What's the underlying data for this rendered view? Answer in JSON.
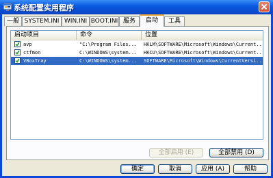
{
  "window": {
    "title": "系统配置实用程序"
  },
  "tabs": [
    {
      "label": "一般"
    },
    {
      "label": "SYSTEM.INI"
    },
    {
      "label": "WIN.INI"
    },
    {
      "label": "BOOT.INI"
    },
    {
      "label": "服务"
    },
    {
      "label": "启动",
      "active": true
    },
    {
      "label": "工具"
    }
  ],
  "startup": {
    "columns": [
      "启动项目",
      "命令",
      "位置"
    ],
    "rows": [
      {
        "checked": true,
        "item": "avp",
        "command": "\"C:\\Program Files...",
        "location": "HKLM\\SOFTWARE\\Microsoft\\Windows\\Current..."
      },
      {
        "checked": true,
        "item": "ctfmon",
        "command": "C:\\WINDOWS\\system...",
        "location": "HKCU\\SOFTWARE\\Microsoft\\Windows\\Current..."
      },
      {
        "checked": true,
        "item": "VBoxTray",
        "command": "C:\\WINDOWS\\system...",
        "location": "SOFTWARE\\Microsoft\\Windows\\CurrentVersi...",
        "selected": true
      }
    ],
    "enable_all": "全部启用 (E)",
    "disable_all": "全部禁用 (D)"
  },
  "footer": {
    "ok": "确定",
    "cancel": "取消",
    "apply": "应用 (A)",
    "help": "帮助"
  },
  "colors": {
    "titlebar": "#0a4fd3",
    "selection": "#316ac5",
    "active_tab_accent": "#f7a83c",
    "close_button": "#d9512d"
  },
  "icons": {
    "title": "system-config-icon",
    "close": "close-icon",
    "checkbox": "checkmark-icon"
  }
}
